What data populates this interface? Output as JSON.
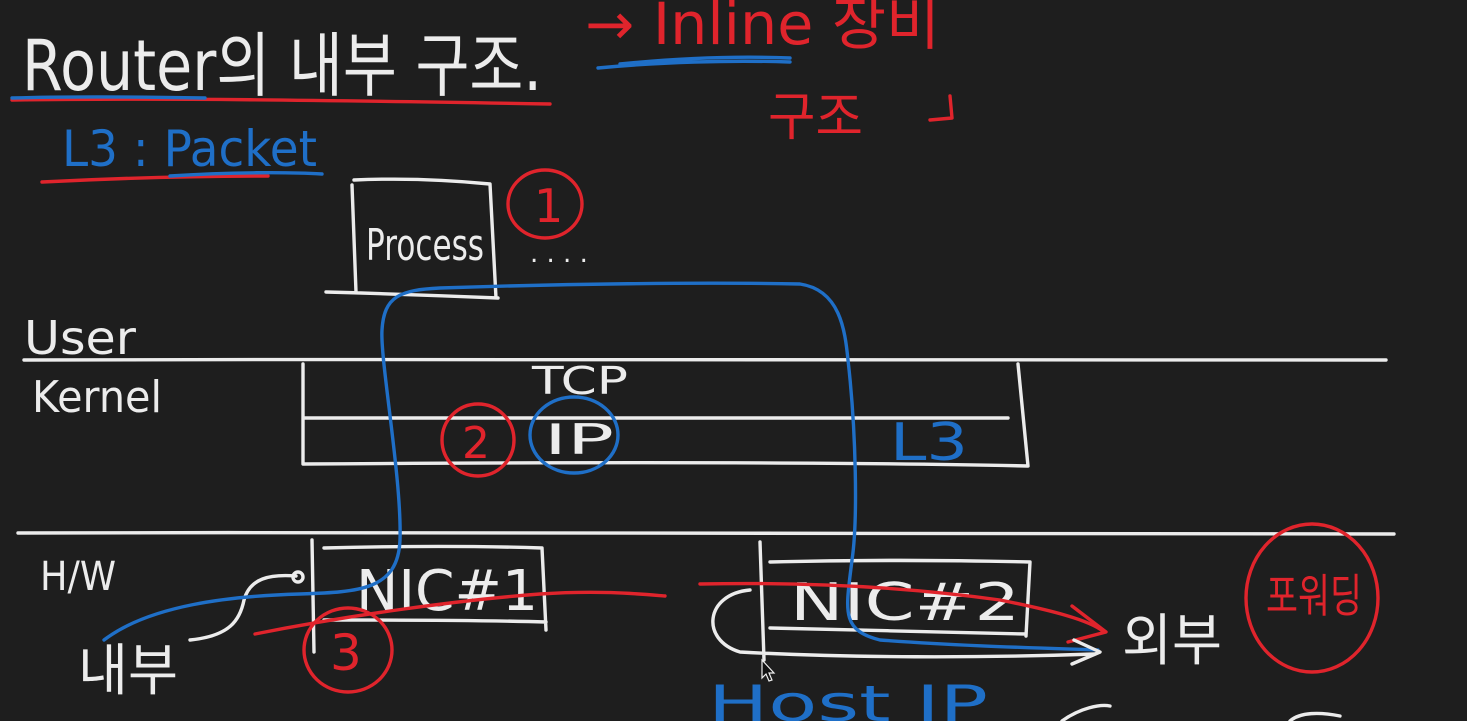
{
  "title": "Router의 내부 구조.",
  "subtitle": "L3 : Packet",
  "annotation_inline": "→ Inline 장비",
  "annotation_inline_sub": "구조",
  "process_label": "Process",
  "step_marks": [
    "1",
    "2",
    "3"
  ],
  "dots": ". . . .",
  "layer_user": "User",
  "layer_kernel": "Kernel",
  "layer_hw": "H/W",
  "stack_top": "TCP",
  "stack_ip": "IP",
  "stack_layer": "L3",
  "nic1": "NIC#1",
  "nic2": "NIC#2",
  "inside": "내부",
  "outside": "외부",
  "forwarding": "포워딩",
  "bottom_partial": "Host IP",
  "colors": {
    "background": "#1e1e1e",
    "chalk": "#ececec",
    "blue": "#1f6fc7",
    "red": "#e0242c"
  }
}
